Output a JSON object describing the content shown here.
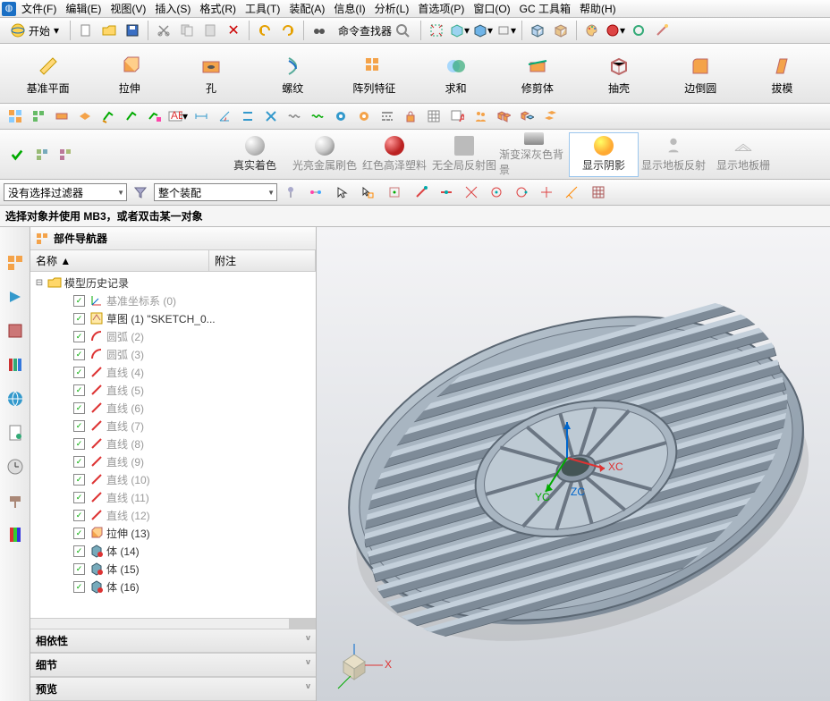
{
  "menu": {
    "file": "文件(F)",
    "edit": "编辑(E)",
    "view": "视图(V)",
    "insert": "插入(S)",
    "format": "格式(R)",
    "tools": "工具(T)",
    "assembly": "装配(A)",
    "info": "信息(I)",
    "analyze": "分析(L)",
    "pref": "首选项(P)",
    "window": "窗口(O)",
    "gc": "GC 工具箱",
    "help": "帮助(H)"
  },
  "start": "开始",
  "cmdfinder": "命令查找器",
  "ribbon": {
    "datum": "基准平面",
    "extrude": "拉伸",
    "hole": "孔",
    "thread": "螺纹",
    "pattern": "阵列特征",
    "sum": "求和",
    "trim": "修剪体",
    "shell": "抽壳",
    "fillet": "边倒圆",
    "draft": "拔模"
  },
  "render": {
    "real": "真实着色",
    "metal": "光亮金属刷色",
    "plastic": "红色高泽塑料",
    "noreflect": "无全局反射图",
    "graygrad": "渐变深灰色背景",
    "shadow": "显示阴影",
    "floorrefl": "显示地板反射",
    "floorgrid": "显示地板栅"
  },
  "filter": {
    "none": "没有选择过滤器",
    "whole": "整个装配"
  },
  "status": "选择对象并使用 MB3，或者双击某一对象",
  "nav": {
    "title": "部件导航器",
    "col_name": "名称",
    "col_note": "附注",
    "root": "模型历史记录",
    "items": [
      {
        "label": "基准坐标系 (0)",
        "ic": "csys"
      },
      {
        "label": "草图 (1) \"SKETCH_0...",
        "ic": "sketch",
        "dark": true
      },
      {
        "label": "圆弧 (2)",
        "ic": "arc"
      },
      {
        "label": "圆弧 (3)",
        "ic": "arc"
      },
      {
        "label": "直线 (4)",
        "ic": "line"
      },
      {
        "label": "直线 (5)",
        "ic": "line"
      },
      {
        "label": "直线 (6)",
        "ic": "line"
      },
      {
        "label": "直线 (7)",
        "ic": "line"
      },
      {
        "label": "直线 (8)",
        "ic": "line"
      },
      {
        "label": "直线 (9)",
        "ic": "line"
      },
      {
        "label": "直线 (10)",
        "ic": "line"
      },
      {
        "label": "直线 (11)",
        "ic": "line"
      },
      {
        "label": "直线 (12)",
        "ic": "line"
      },
      {
        "label": "拉伸 (13)",
        "ic": "extr",
        "dark": true
      },
      {
        "label": "体 (14)",
        "ic": "body",
        "dark": true
      },
      {
        "label": "体 (15)",
        "ic": "body",
        "dark": true
      },
      {
        "label": "体 (16)",
        "ic": "body",
        "dark": true
      }
    ],
    "sec_dep": "相依性",
    "sec_detail": "细节",
    "sec_prev": "预览"
  },
  "axes": {
    "x": "XC",
    "y": "YC",
    "z": "ZC"
  }
}
